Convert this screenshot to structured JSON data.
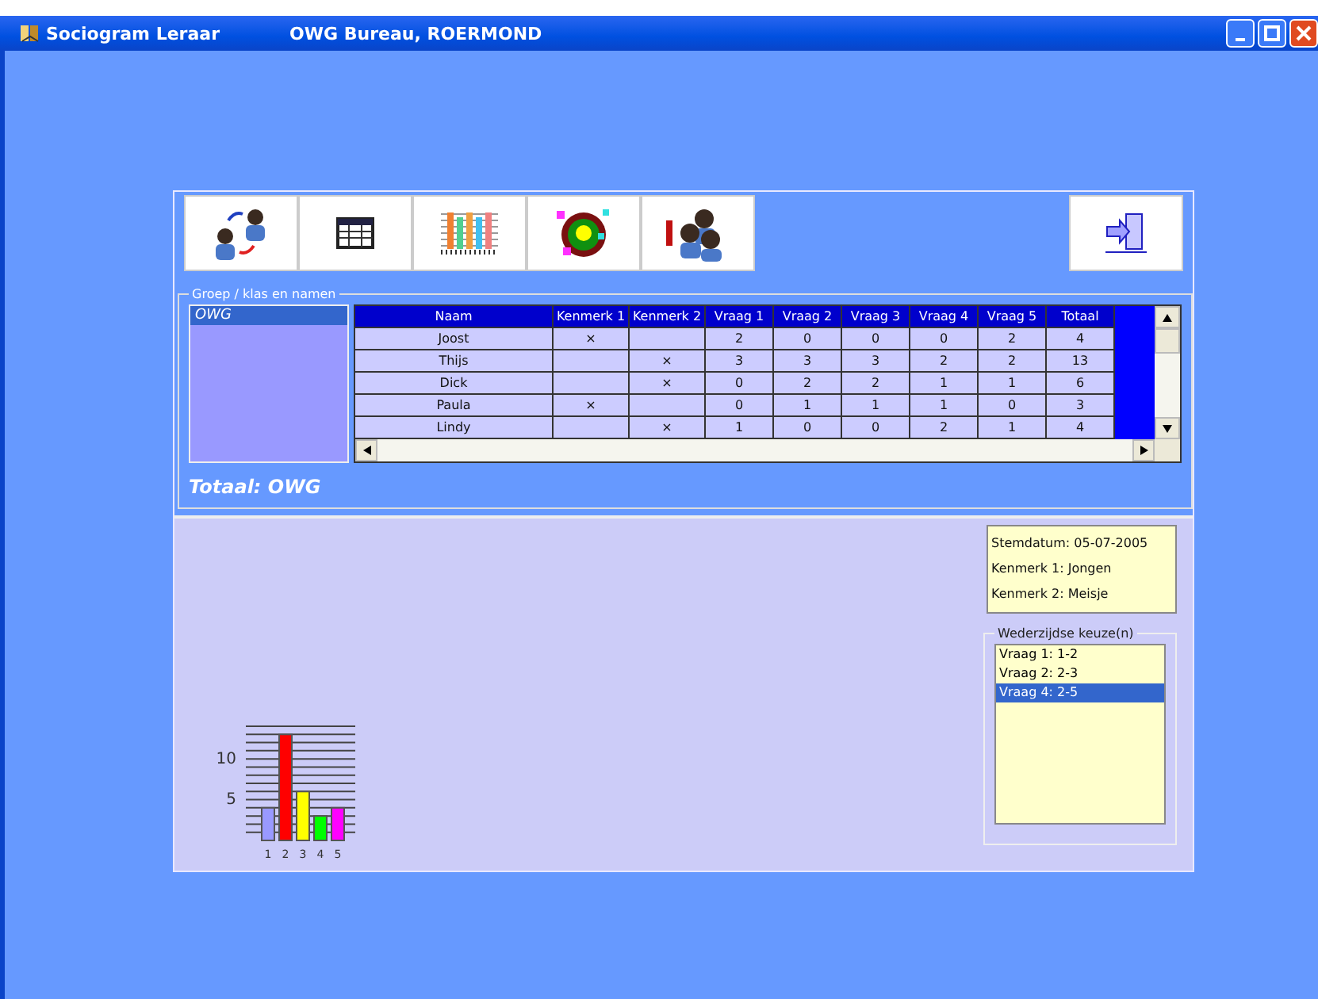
{
  "window": {
    "title": "Sociogram Leraar",
    "subtitle": "OWG Bureau, ROERMOND"
  },
  "toolbar": [
    {
      "kind": "swap"
    },
    {
      "kind": "table"
    },
    {
      "kind": "bars"
    },
    {
      "kind": "target"
    },
    {
      "kind": "people"
    }
  ],
  "exit_button": {
    "kind": "exit"
  },
  "group": {
    "legend": "Groep / klas en namen",
    "classes": [
      {
        "name": "OWG",
        "selected": true
      }
    ],
    "total": "Totaal: OWG"
  },
  "table": {
    "columns": [
      "Naam",
      "Kenmerk 1",
      "Kenmerk 2",
      "Vraag 1",
      "Vraag 2",
      "Vraag 3",
      "Vraag 4",
      "Vraag 5",
      "Totaal"
    ],
    "rows": [
      [
        "Joost",
        "×",
        "",
        "2",
        "0",
        "0",
        "0",
        "2",
        "4"
      ],
      [
        "Thijs",
        "",
        "×",
        "3",
        "3",
        "3",
        "2",
        "2",
        "13"
      ],
      [
        "Dick",
        "",
        "×",
        "0",
        "2",
        "2",
        "1",
        "1",
        "6"
      ],
      [
        "Paula",
        "×",
        "",
        "0",
        "1",
        "1",
        "1",
        "0",
        "3"
      ],
      [
        "Lindy",
        "",
        "×",
        "1",
        "0",
        "0",
        "2",
        "1",
        "4"
      ]
    ]
  },
  "info": [
    "Stemdatum: 05-07-2005",
    "Kenmerk 1: Jongen",
    "Kenmerk 2: Meisje"
  ],
  "mutual": {
    "legend": "Wederzijdse keuze(n)",
    "items": [
      {
        "label": "Vraag  1: 1-2",
        "selected": false
      },
      {
        "label": "Vraag  2: 2-3",
        "selected": false
      },
      {
        "label": "Vraag  4: 2-5",
        "selected": true
      }
    ]
  },
  "chart_data": {
    "type": "bar",
    "categories": [
      "1",
      "2",
      "3",
      "4",
      "5"
    ],
    "series": [
      {
        "colors": [
          "#9999ff",
          "#ff0000",
          "#ffff00",
          "#00ff00",
          "#ff00ff"
        ],
        "values": [
          4,
          13,
          6,
          3,
          4
        ]
      }
    ],
    "ylim": [
      0,
      14
    ],
    "yticks": [
      5,
      10
    ]
  }
}
